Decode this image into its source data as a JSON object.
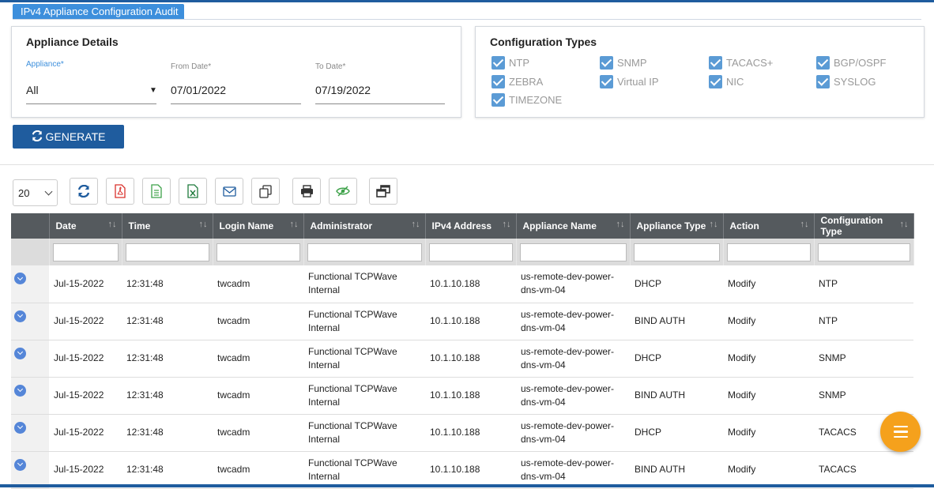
{
  "page": {
    "tab_title": "IPv4 Appliance Configuration Audit"
  },
  "appliance_details": {
    "title": "Appliance Details",
    "appliance_label": "Appliance*",
    "appliance_value": "All",
    "from_label": "From Date*",
    "from_value": "07/01/2022",
    "to_label": "To Date*",
    "to_value": "07/19/2022"
  },
  "configuration_types": {
    "title": "Configuration Types",
    "items": [
      "NTP",
      "SNMP",
      "TACACS+",
      "BGP/OSPF",
      "ZEBRA",
      "Virtual IP",
      "NIC",
      "SYSLOG",
      "TIMEZONE"
    ]
  },
  "generate_label": "GENERATE",
  "toolbar": {
    "page_size": "20"
  },
  "table": {
    "columns": [
      "Date",
      "Time",
      "Login Name",
      "Administrator",
      "IPv4 Address",
      "Appliance Name",
      "Appliance Type",
      "Action",
      "Configuration Type"
    ],
    "rows": [
      [
        "Jul-15-2022",
        "12:31:48",
        "twcadm",
        "Functional TCPWave Internal",
        "10.1.10.188",
        "us-remote-dev-power-dns-vm-04",
        "DHCP",
        "Modify",
        "NTP"
      ],
      [
        "Jul-15-2022",
        "12:31:48",
        "twcadm",
        "Functional TCPWave Internal",
        "10.1.10.188",
        "us-remote-dev-power-dns-vm-04",
        "BIND AUTH",
        "Modify",
        "NTP"
      ],
      [
        "Jul-15-2022",
        "12:31:48",
        "twcadm",
        "Functional TCPWave Internal",
        "10.1.10.188",
        "us-remote-dev-power-dns-vm-04",
        "DHCP",
        "Modify",
        "SNMP"
      ],
      [
        "Jul-15-2022",
        "12:31:48",
        "twcadm",
        "Functional TCPWave Internal",
        "10.1.10.188",
        "us-remote-dev-power-dns-vm-04",
        "BIND AUTH",
        "Modify",
        "SNMP"
      ],
      [
        "Jul-15-2022",
        "12:31:48",
        "twcadm",
        "Functional TCPWave Internal",
        "10.1.10.188",
        "us-remote-dev-power-dns-vm-04",
        "DHCP",
        "Modify",
        "TACACS"
      ],
      [
        "Jul-15-2022",
        "12:31:48",
        "twcadm",
        "Functional TCPWave Internal",
        "10.1.10.188",
        "us-remote-dev-power-dns-vm-04",
        "BIND AUTH",
        "Modify",
        "TACACS"
      ]
    ]
  },
  "colors": {
    "primary": "#1f5c9e",
    "accent": "#3d8fdc",
    "checkbox": "#5b9bd5",
    "header": "#555a5e",
    "fab": "#f5a11c"
  },
  "icons": {
    "toolbar": [
      "refresh-icon",
      "pdf-icon",
      "document-icon",
      "excel-icon",
      "email-icon",
      "copy-icon",
      "print-icon",
      "visibility-icon",
      "columns-icon"
    ],
    "fab": "menu-icon",
    "row_expand": "chevron-down-icon"
  }
}
